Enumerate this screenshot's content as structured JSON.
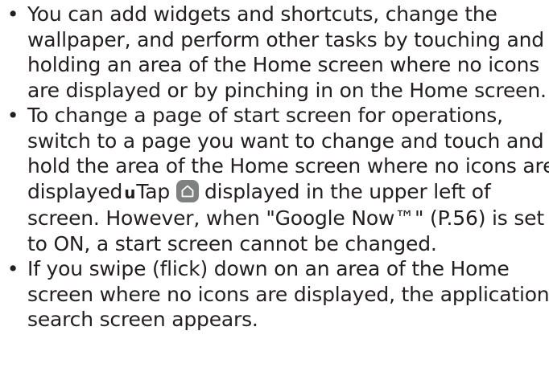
{
  "bullets": [
    {
      "mark": "•",
      "lines": [
        "You can add widgets and shortcuts, change the",
        "wallpaper, and perform other tasks by touching and",
        "holding an area of the Home screen where no icons",
        "are displayed or by pinching in on the Home screen."
      ]
    },
    {
      "mark": "•",
      "lines": [
        "To change a page of start screen for operations,",
        "switch to a page you want to change and touch and",
        "hold the area of the Home screen where no icons are"
      ],
      "inline_line": {
        "before_arrow": "displayed",
        "arrow": "u",
        "before_icon": "Tap",
        "icon": "home-icon",
        "after_icon": "displayed in the upper left of"
      },
      "tail_lines": [
        "screen. However, when \"Google Now™\" (P.56) is set",
        "to ON, a start screen cannot be changed."
      ]
    },
    {
      "mark": "•",
      "lines": [
        "If you swipe (flick) down on an area of the Home",
        "screen where no icons are displayed, the applications",
        "search screen appears."
      ]
    }
  ],
  "colors": {
    "text": "#231f20",
    "icon_background": "#7f8181",
    "icon_foreground": "#ffffff"
  }
}
